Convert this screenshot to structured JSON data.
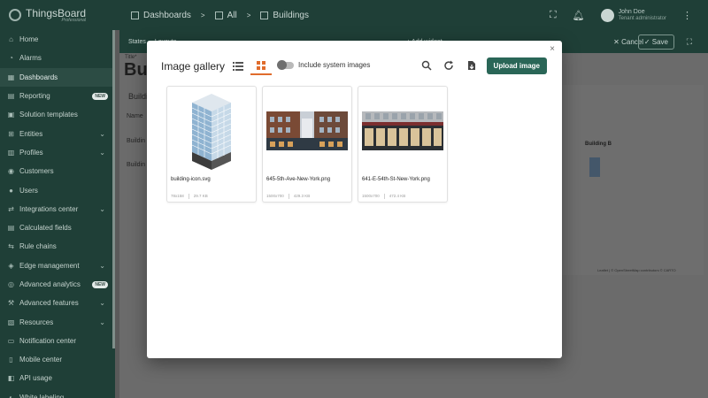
{
  "app": {
    "logo_name": "ThingsBoard",
    "logo_sub": "Professional"
  },
  "breadcrumb": {
    "items": [
      "Dashboards",
      "All",
      "Buildings"
    ],
    "separator": ">"
  },
  "user": {
    "name": "John Doe",
    "role": "Tenant administrator"
  },
  "sidebar": {
    "items": [
      {
        "label": "Home",
        "icon": "home-icon"
      },
      {
        "label": "Alarms",
        "icon": "alarm-icon"
      },
      {
        "label": "Dashboards",
        "icon": "dashboards-icon",
        "active": true
      },
      {
        "label": "Reporting",
        "icon": "reporting-icon",
        "badge": "NEW"
      },
      {
        "label": "Solution templates",
        "icon": "templates-icon"
      },
      {
        "label": "Entities",
        "icon": "entities-icon",
        "chevron": true
      },
      {
        "label": "Profiles",
        "icon": "profiles-icon",
        "chevron": true
      },
      {
        "label": "Customers",
        "icon": "customers-icon"
      },
      {
        "label": "Users",
        "icon": "users-icon"
      },
      {
        "label": "Integrations center",
        "icon": "integrations-icon",
        "chevron": true
      },
      {
        "label": "Calculated fields",
        "icon": "calculated-icon"
      },
      {
        "label": "Rule chains",
        "icon": "rule-chains-icon"
      },
      {
        "label": "Edge management",
        "icon": "edge-icon",
        "chevron": true
      },
      {
        "label": "Advanced analytics",
        "icon": "analytics-icon",
        "badge": "NEW"
      },
      {
        "label": "Advanced features",
        "icon": "features-icon",
        "chevron": true
      },
      {
        "label": "Resources",
        "icon": "resources-icon",
        "chevron": true
      },
      {
        "label": "Notification center",
        "icon": "notification-icon"
      },
      {
        "label": "Mobile center",
        "icon": "mobile-icon"
      },
      {
        "label": "API usage",
        "icon": "api-icon"
      },
      {
        "label": "White labeling",
        "icon": "white-label-icon"
      }
    ]
  },
  "toolbar": {
    "states_label": "States",
    "layouts_label": "Layouts",
    "add_widget_label": "+ Add widget",
    "cancel_label": "Cancel",
    "save_label": "Save"
  },
  "background": {
    "title_small": "Title*",
    "title": "Buil",
    "card_title": "Buildi",
    "col_name": "Name",
    "row1": "Buildin",
    "row2": "Buildin",
    "map_label": "Building B",
    "map_attrib": "Leaflet | © OpenStreetMap contributors © CARTO"
  },
  "modal": {
    "title": "Image gallery",
    "toggle_label": "Include system images",
    "upload_label": "Upload image",
    "close": "×",
    "images": [
      {
        "name": "building-icon.svg",
        "dimensions": "78x158",
        "size": "29.7 KB",
        "kind": "svg"
      },
      {
        "name": "645-5th-Ave-New-York.png",
        "dimensions": "1500x700",
        "size": "429.3 KB",
        "kind": "photo1"
      },
      {
        "name": "641-E-54th-St-New-York.png",
        "dimensions": "1500x700",
        "size": "472.4 KB",
        "kind": "photo2"
      }
    ]
  },
  "colors": {
    "sidebar_bg": "#1f3f37",
    "accent": "#2a6657",
    "active_tab": "#e06c2c"
  }
}
